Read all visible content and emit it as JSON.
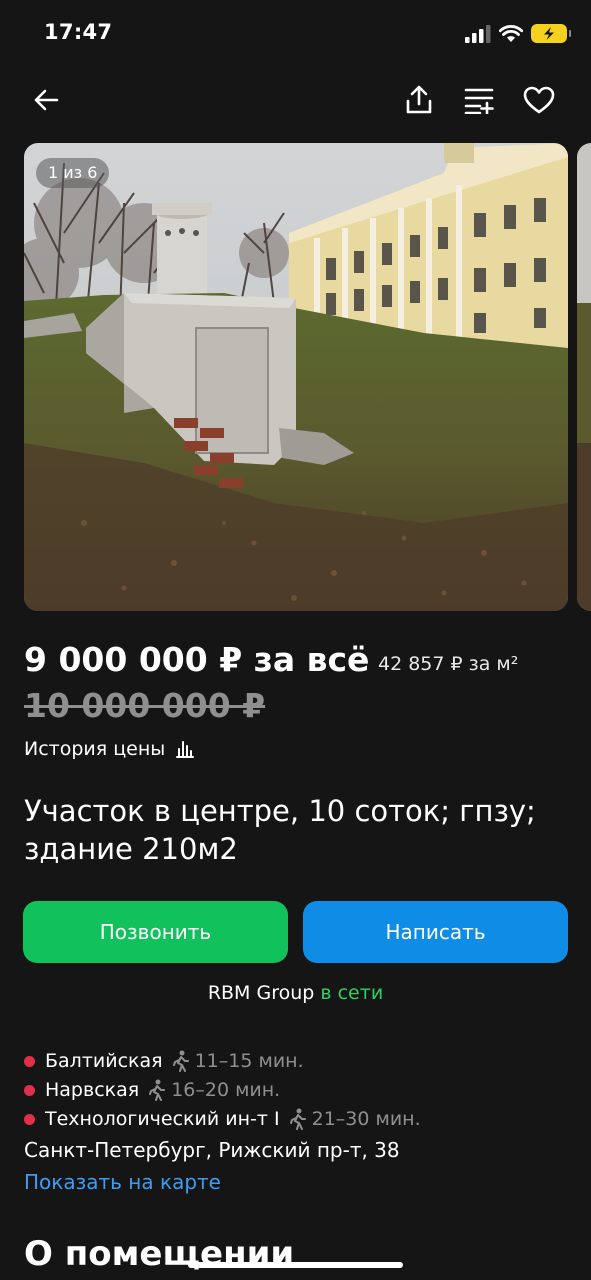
{
  "status_bar": {
    "time": "17:47"
  },
  "gallery": {
    "counter": "1 из 6"
  },
  "listing": {
    "price": "9 000 000 ₽ за всё",
    "price_per_sqm": "42 857 ₽ за м²",
    "old_price": "10 000 000 ₽",
    "price_history_label": "История цены",
    "title": "Участок в центре, 10 соток; гпзу; здание 210м2"
  },
  "actions": {
    "call_label": "Позвонить",
    "write_label": "Написать"
  },
  "seller": {
    "name": "RBM Group",
    "status": "в сети"
  },
  "metro": [
    {
      "name": "Балтийская",
      "time": "11–15 мин.",
      "color": "#e0304a"
    },
    {
      "name": "Нарвская",
      "time": "16–20 мин.",
      "color": "#e0304a"
    },
    {
      "name": "Технологический ин-т I",
      "time": "21–30 мин.",
      "color": "#e0304a"
    }
  ],
  "location": {
    "address": "Санкт-Петербург, Рижский пр-т, 38",
    "map_link": "Показать на карте"
  },
  "section_title": "О помещении"
}
